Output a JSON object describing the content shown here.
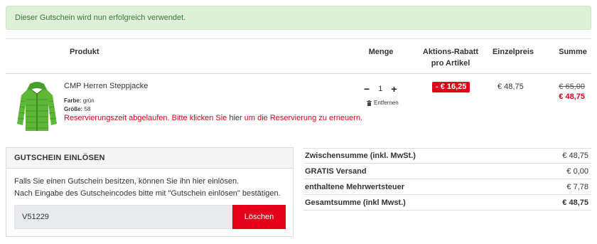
{
  "alert": {
    "message": "Dieser Gutschein wird nun erfolgreich verwendet."
  },
  "table_headers": {
    "produkt": "Produkt",
    "menge": "Menge",
    "rabatt_line1": "Aktions-Rabatt",
    "rabatt_line2": "pro Artikel",
    "einzelpreis": "Einzelpreis",
    "summe": "Summe"
  },
  "item": {
    "name": "CMP Herren Steppjacke",
    "farbe_label": "Farbe:",
    "farbe_value": "grün",
    "groesse_label": "Größe:",
    "groesse_value": "58",
    "reservation_part1": "Reservierungszeit abgelaufen. Bitte klicken Sie",
    "reservation_link": "hier",
    "reservation_part2": "um die Reservierung zu erneuern.",
    "quantity": "1",
    "minus": "−",
    "plus": "+",
    "remove_label": "Entfernen",
    "discount": "- € 16,25",
    "unit_price": "€ 48,75",
    "old_total": "€ 65,00",
    "new_total": "€ 48,75",
    "image_icon": "green-quilted-jacket"
  },
  "voucher": {
    "title": "GUTSCHEIN EINLÖSEN",
    "text_line1": "Falls Sie einen Gutschein besitzen, können Sie ihn hier einlösen.",
    "text_line2": "Nach Eingabe des Gutscheincodes bitte mit \"Gutschein einlösen\" bestätigen.",
    "code": "V51229",
    "button_label": "Löschen"
  },
  "totals": [
    {
      "label": "Zwischensumme (inkl. MwSt.)",
      "value": "€ 48,75"
    },
    {
      "label": "GRATIS Versand",
      "value": "€ 0,00"
    },
    {
      "label": "enthaltene Mehrwertsteuer",
      "value": "€ 7,78"
    },
    {
      "label": "Gesamtsumme (inkl Mwst.)",
      "value": "€ 48,75"
    }
  ],
  "colors": {
    "accent_red": "#e2001a",
    "success_bg": "#dff0d8",
    "success_text": "#3c763d",
    "jacket_green": "#5cb836"
  }
}
